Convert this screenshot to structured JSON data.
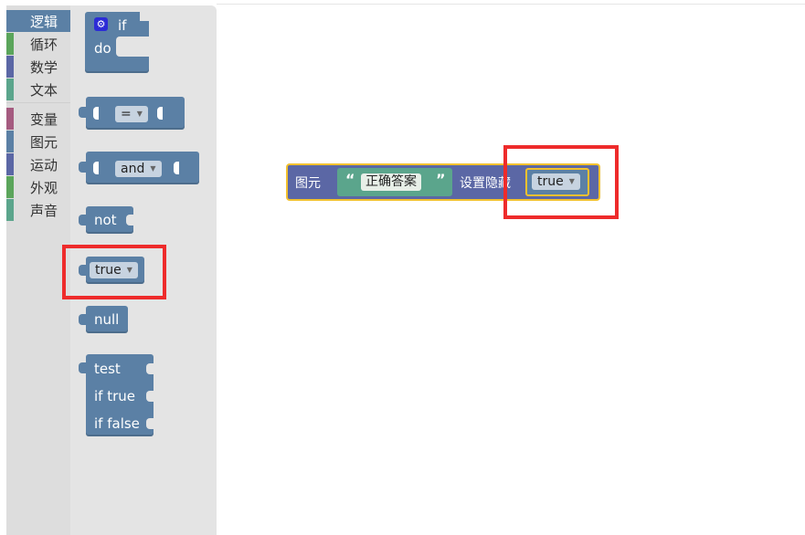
{
  "toolbox": {
    "categories": [
      {
        "label": "逻辑",
        "color": "#5b80a5",
        "selected": true
      },
      {
        "label": "循环",
        "color": "#5ba55b"
      },
      {
        "label": "数学",
        "color": "#5b67a5"
      },
      {
        "label": "文本",
        "color": "#5ba58c"
      },
      {
        "label": "变量",
        "color": "#a55b80"
      },
      {
        "label": "图元",
        "color": "#5b80a5"
      },
      {
        "label": "运动",
        "color": "#5b67a5"
      },
      {
        "label": "外观",
        "color": "#5ba55b"
      },
      {
        "label": "声音",
        "color": "#5ba58c"
      }
    ]
  },
  "flyout": {
    "if_block": {
      "if_label": "if",
      "do_label": "do"
    },
    "compare_block": {
      "operator": "="
    },
    "logic_op_block": {
      "operator": "and"
    },
    "not_block": {
      "label": "not"
    },
    "boolean_block": {
      "value": "true"
    },
    "null_block": {
      "label": "null"
    },
    "ternary_block": {
      "test_label": "test",
      "if_true_label": "if true",
      "if_false_label": "if false"
    }
  },
  "workspace": {
    "sprite_block": {
      "label": "图元",
      "quote_open": "“",
      "string_value": "正确答案",
      "quote_close": "”",
      "action_label": "设置隐藏",
      "boolean_value": "true"
    }
  },
  "colors": {
    "logic_block": "#5b80a5",
    "sprite_block": "#5b67a5",
    "text_block": "#5ba58c",
    "highlight_outline": "#f2c12e",
    "red_annotation": "#ee2b2b"
  }
}
